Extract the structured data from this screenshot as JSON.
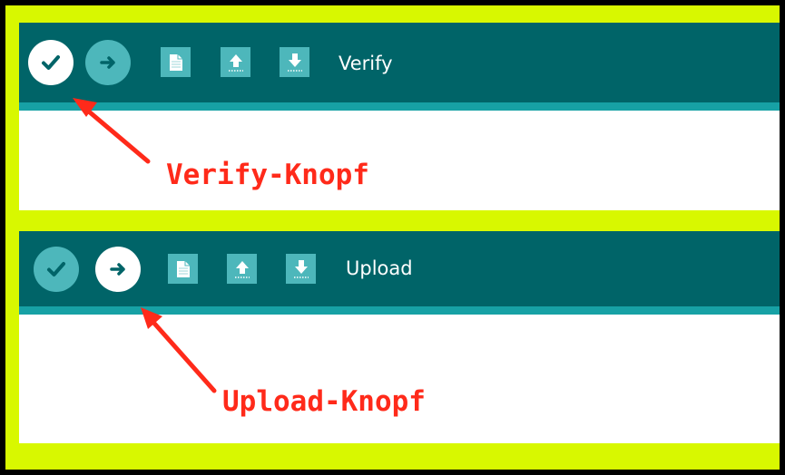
{
  "colors": {
    "background_frame": "#d8f800",
    "toolbar": "#006468",
    "toolbar_stripe": "#17a1a5",
    "button": "#4db7bb",
    "button_active": "#ffffff",
    "annotation": "#ff2a1a"
  },
  "top_panel": {
    "toolbar_label": "Verify",
    "annotation": "Verify-Knopf",
    "active_button": "verify",
    "buttons": [
      "verify",
      "upload",
      "new",
      "open",
      "save"
    ]
  },
  "bottom_panel": {
    "toolbar_label": "Upload",
    "annotation": "Upload-Knopf",
    "active_button": "upload",
    "buttons": [
      "verify",
      "upload",
      "new",
      "open",
      "save"
    ]
  },
  "icons": {
    "verify": "checkmark-icon",
    "upload": "arrow-right-icon",
    "new": "new-file-icon",
    "open": "open-arrow-up-icon",
    "save": "save-arrow-down-icon"
  }
}
